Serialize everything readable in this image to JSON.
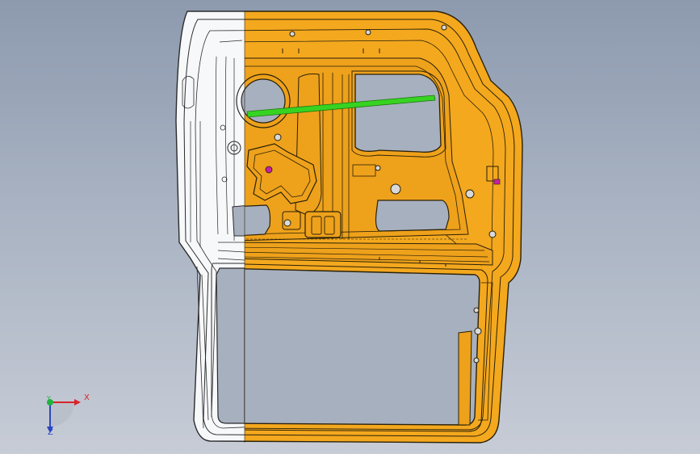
{
  "viewport": {
    "background_top": "#8d9aae",
    "background_bottom": "#c7ccd6"
  },
  "model": {
    "part_color": "#f4a81e",
    "edge_color": "#2a2108",
    "wire_color": "#2b2b2b",
    "guide_rail_color": "#37d321",
    "marker_color": "#c81fa6"
  },
  "triad": {
    "x_label": "X",
    "y_label": "Y",
    "z_label": "Z",
    "x_color": "#d8252a",
    "y_color": "#1fb340",
    "z_color": "#2b46c2"
  }
}
